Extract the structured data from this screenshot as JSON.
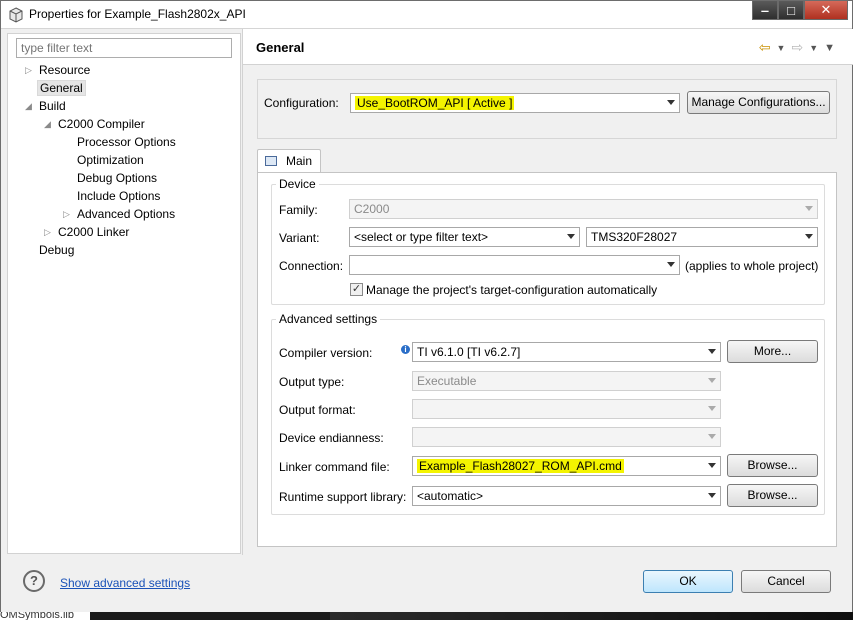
{
  "window": {
    "title": "Properties for Example_Flash2802x_API"
  },
  "filter": {
    "placeholder": "type filter text"
  },
  "tree": {
    "resource": "Resource",
    "general": "General",
    "build": "Build",
    "c2000_compiler": "C2000 Compiler",
    "processor_options": "Processor Options",
    "optimization": "Optimization",
    "debug_options": "Debug Options",
    "include_options": "Include Options",
    "advanced_options": "Advanced Options",
    "c2000_linker": "C2000 Linker",
    "debug": "Debug"
  },
  "page": {
    "title": "General"
  },
  "configuration": {
    "label": "Configuration:",
    "value": "Use_BootROM_API  [ Active ]",
    "manage_button": "Manage Configurations..."
  },
  "tab": {
    "main": "Main"
  },
  "device": {
    "group_title": "Device",
    "family_label": "Family:",
    "family_value": "C2000",
    "variant_label": "Variant:",
    "variant_filter": "<select or type filter text>",
    "variant_value": "TMS320F28027",
    "connection_label": "Connection:",
    "connection_value": "",
    "connection_note": "(applies to whole project)",
    "manage_target_label": "Manage the project's target-configuration automatically",
    "manage_target_checked": "✓"
  },
  "advanced": {
    "group_title": "Advanced settings",
    "compiler_label": "Compiler version:",
    "compiler_value": "TI v6.1.0  [TI v6.2.7]",
    "more_button": "More...",
    "output_type_label": "Output type:",
    "output_type_value": "Executable",
    "output_format_label": "Output format:",
    "output_format_value": "",
    "endianness_label": "Device endianness:",
    "endianness_value": "",
    "linker_label": "Linker command file:",
    "linker_value": "Example_Flash28027_ROM_API.cmd",
    "browse_button": "Browse...",
    "runtime_label": "Runtime support library:",
    "runtime_value": "<automatic>"
  },
  "footer": {
    "help_glyph": "?",
    "advanced_link": "Show advanced settings",
    "ok_button": "OK",
    "cancel_button": "Cancel"
  },
  "background": {
    "behind_text": "OMSymbols.lib"
  },
  "colors": {
    "highlight": "#f4f400",
    "link": "#1a52b8",
    "window_bg": "#f0f0f0"
  }
}
